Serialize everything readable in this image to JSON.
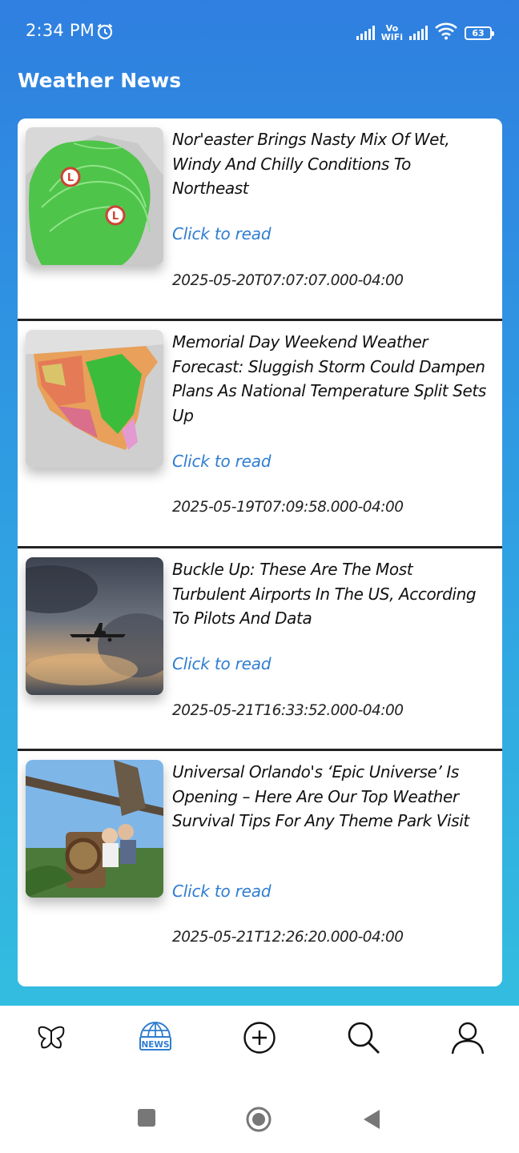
{
  "status_bar": {
    "time": "2:34 PM",
    "vowifi_line1": "Vo",
    "vowifi_line2": "WiFi",
    "battery": "63"
  },
  "app": {
    "title": "Weather News"
  },
  "articles": [
    {
      "title": "Nor'easter Brings Nasty Mix Of Wet, Windy And Chilly Conditions To Northeast",
      "link_label": "Click to read",
      "date": "2025-05-20T07:07:07.000-04:00",
      "image": "radar-map-image"
    },
    {
      "title": "Memorial Day Weekend Weather Forecast: Sluggish Storm Could Dampen Plans As National Temperature Split Sets Up",
      "link_label": "Click to read",
      "date": "2025-05-19T07:09:58.000-04:00",
      "image": "temperature-map-image"
    },
    {
      "title": "Buckle Up: These Are The Most Turbulent Airports In The US, According To Pilots And Data",
      "link_label": "Click to read",
      "date": "2025-05-21T16:33:52.000-04:00",
      "image": "airplane-storm-image"
    },
    {
      "title": "Universal Orlando's ‘Epic Universe’ Is Opening – Here Are Our Top Weather Survival Tips For Any Theme Park Visit",
      "link_label": "Click to read",
      "date": "2025-05-21T12:26:20.000-04:00",
      "image": "roller-coaster-image"
    }
  ],
  "bottom_nav": {
    "items": [
      {
        "icon": "butterfly-icon",
        "active": false
      },
      {
        "icon": "news-globe-icon",
        "label": "NEWS",
        "active": true
      },
      {
        "icon": "add-circle-icon",
        "active": false
      },
      {
        "icon": "search-icon",
        "active": false
      },
      {
        "icon": "profile-icon",
        "active": false
      }
    ],
    "active_color": "#2f7dd1"
  },
  "colors": {
    "gradient_top": "#2f7fe0",
    "gradient_bottom": "#33bde0",
    "link": "#2f7dd1"
  }
}
